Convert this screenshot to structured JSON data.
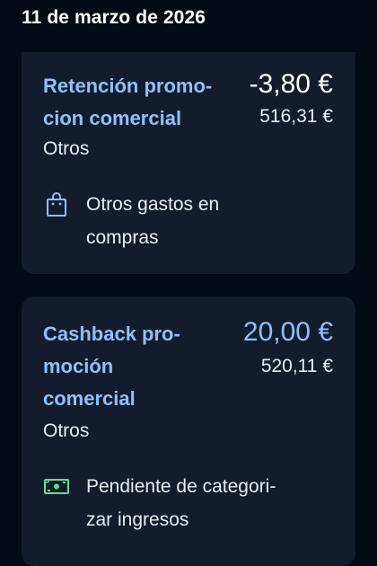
{
  "date_header": "11 de marzo de 2026",
  "transactions": [
    {
      "title_lines": [
        "Retención promo-",
        "cion comercial"
      ],
      "amount": "-3,80 €",
      "balance": "516,31 €",
      "subcategory": "Otros",
      "category_lines": [
        "Otros gastos en",
        "compras"
      ],
      "category_icon": "shopping-bag-icon"
    },
    {
      "title_lines": [
        "Cashback pro-",
        "moción",
        "comercial"
      ],
      "amount": "20,00 €",
      "balance": "520,11 €",
      "subcategory": "Otros",
      "category_lines": [
        "Pendiente de categori-",
        "zar ingresos"
      ],
      "category_icon": "banknote-icon"
    }
  ],
  "colors": {
    "background": "#050a17",
    "card": "#131c2c",
    "accent_blue": "#8fc0ff",
    "banknote_green": "#5fe08a"
  }
}
